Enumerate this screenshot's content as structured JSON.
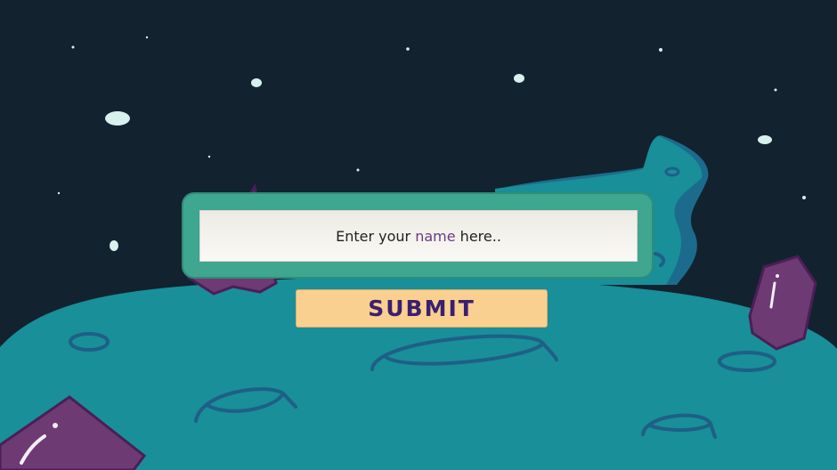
{
  "colors": {
    "sky": "#12222f",
    "star": "#d8f0ee",
    "ground": "#188f99",
    "ground_dark": "#1c6b8c",
    "crater": "#1f5f86",
    "crystal": "#6e3a74",
    "crystal_outline": "#4a1f55",
    "panel": "#3fa68f",
    "field": "#f5f4ef",
    "button": "#f9d08f",
    "button_text": "#3a2070",
    "accent_text": "#6b3a84"
  },
  "form": {
    "placeholder_prefix": "Enter your",
    "placeholder_accent": "name",
    "placeholder_suffix": "here..",
    "submit_label": "SUBMIT"
  }
}
